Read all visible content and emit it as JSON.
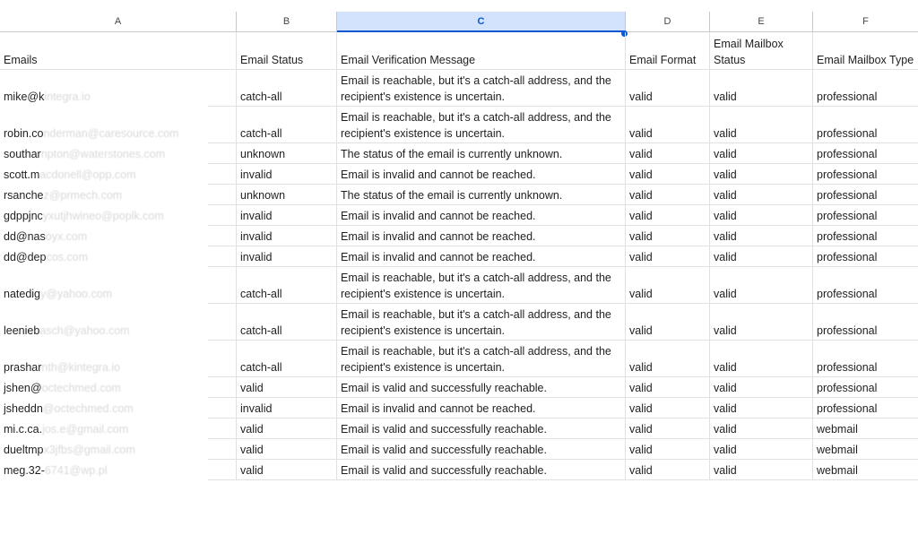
{
  "column_letters": [
    "A",
    "B",
    "C",
    "D",
    "E",
    "F"
  ],
  "headers": {
    "a": "Emails",
    "b": "Email Status",
    "c": "Email Verification Message",
    "d": "Email Format",
    "e": "Email Mailbox Status",
    "f": "Email Mailbox Type"
  },
  "rows": [
    {
      "email_vis": "mike@k",
      "email_blur": "integra.io",
      "status": "catch-all",
      "message": "Email is reachable, but it's a catch-all address, and the recipient's existence is uncertain.",
      "format": "valid",
      "mailbox_status": "valid",
      "mailbox_type": "professional"
    },
    {
      "email_vis": "robin.co",
      "email_blur": "nderman@caresource.com",
      "status": "catch-all",
      "message": "Email is reachable, but it's a catch-all address, and the recipient's existence is uncertain.",
      "format": "valid",
      "mailbox_status": "valid",
      "mailbox_type": "professional"
    },
    {
      "email_vis": "southar",
      "email_blur": "npton@waterstones.com",
      "status": "unknown",
      "message": "The status of the email is currently unknown.",
      "format": "valid",
      "mailbox_status": "valid",
      "mailbox_type": "professional"
    },
    {
      "email_vis": "scott.m",
      "email_blur": "acdonell@opp.com",
      "status": "invalid",
      "message": "Email is invalid and cannot be reached.",
      "format": "valid",
      "mailbox_status": "valid",
      "mailbox_type": "professional"
    },
    {
      "email_vis": "rsanche",
      "email_blur": "z@prmech.com",
      "status": "unknown",
      "message": "The status of the email is currently unknown.",
      "format": "valid",
      "mailbox_status": "valid",
      "mailbox_type": "professional"
    },
    {
      "email_vis": "gdppjnc",
      "email_blur": "yxutjhwineo@poplk.com",
      "status": "invalid",
      "message": "Email is invalid and cannot be reached.",
      "format": "valid",
      "mailbox_status": "valid",
      "mailbox_type": "professional"
    },
    {
      "email_vis": "dd@nas",
      "email_blur": "oyx.com",
      "status": "invalid",
      "message": "Email is invalid and cannot be reached.",
      "format": "valid",
      "mailbox_status": "valid",
      "mailbox_type": "professional"
    },
    {
      "email_vis": "dd@dep",
      "email_blur": "cos.com",
      "status": "invalid",
      "message": "Email is invalid and cannot be reached.",
      "format": "valid",
      "mailbox_status": "valid",
      "mailbox_type": "professional"
    },
    {
      "email_vis": "natedig",
      "email_blur": "y@yahoo.com",
      "status": "catch-all",
      "message": "Email is reachable, but it's a catch-all address, and the recipient's existence is uncertain.",
      "format": "valid",
      "mailbox_status": "valid",
      "mailbox_type": "professional"
    },
    {
      "email_vis": "leenieb",
      "email_blur": "asch@yahoo.com",
      "status": "catch-all",
      "message": "Email is reachable, but it's a catch-all address, and the recipient's existence is uncertain.",
      "format": "valid",
      "mailbox_status": "valid",
      "mailbox_type": "professional"
    },
    {
      "email_vis": "prashar",
      "email_blur": "nth@kintegra.io",
      "status": "catch-all",
      "message": "Email is reachable, but it's a catch-all address, and the recipient's existence is uncertain.",
      "format": "valid",
      "mailbox_status": "valid",
      "mailbox_type": "professional"
    },
    {
      "email_vis": "jshen@",
      "email_blur": "octechmed.com",
      "status": "valid",
      "message": "Email is valid and successfully reachable.",
      "format": "valid",
      "mailbox_status": "valid",
      "mailbox_type": "professional"
    },
    {
      "email_vis": "jsheddn",
      "email_blur": "@octechmed.com",
      "status": "invalid",
      "message": "Email is invalid and cannot be reached.",
      "format": "valid",
      "mailbox_status": "valid",
      "mailbox_type": "professional"
    },
    {
      "email_vis": "mi.c.ca.",
      "email_blur": "jos.e@gmail.com",
      "status": "valid",
      "message": "Email is valid and successfully reachable.",
      "format": "valid",
      "mailbox_status": "valid",
      "mailbox_type": "webmail"
    },
    {
      "email_vis": "dueltmp",
      "email_blur": "x3jfbs@gmail.com",
      "status": "valid",
      "message": "Email is valid and successfully reachable.",
      "format": "valid",
      "mailbox_status": "valid",
      "mailbox_type": "webmail"
    },
    {
      "email_vis": "meg.32-",
      "email_blur": "6741@wp.pl",
      "status": "valid",
      "message": "Email is valid and successfully reachable.",
      "format": "valid",
      "mailbox_status": "valid",
      "mailbox_type": "webmail"
    }
  ]
}
